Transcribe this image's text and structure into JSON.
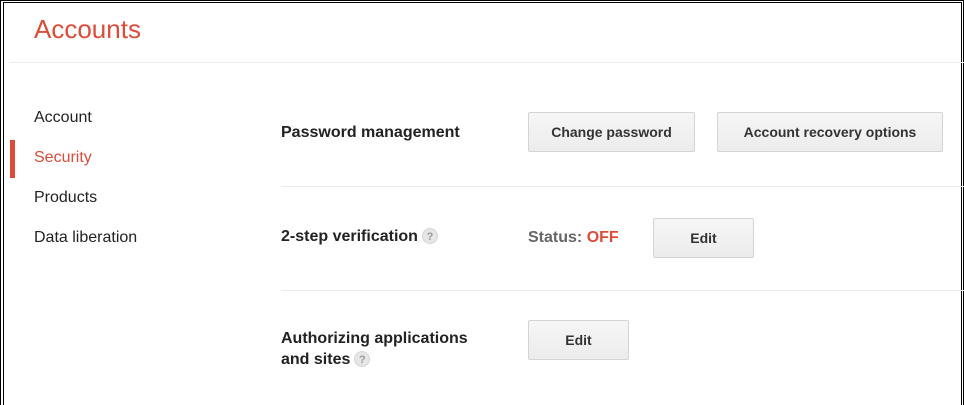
{
  "header": {
    "title": "Accounts"
  },
  "sidebar": {
    "items": [
      {
        "label": "Account",
        "active": false
      },
      {
        "label": "Security",
        "active": true
      },
      {
        "label": "Products",
        "active": false
      },
      {
        "label": "Data liberation",
        "active": false
      }
    ]
  },
  "sections": {
    "password": {
      "label": "Password management",
      "change_password_label": "Change password",
      "recovery_label": "Account recovery options"
    },
    "two_step": {
      "label": "2-step verification",
      "help": "?",
      "status_label": "Status:",
      "status_value": "OFF",
      "edit_label": "Edit"
    },
    "authorizing": {
      "label_line1": "Authorizing applications",
      "label_line2": "and sites",
      "help": "?",
      "edit_label": "Edit"
    }
  },
  "colors": {
    "accent": "#dd4b39",
    "divider": "#ebebeb",
    "button_bg": "#f1f1f1",
    "button_border": "#d4d4d4"
  }
}
